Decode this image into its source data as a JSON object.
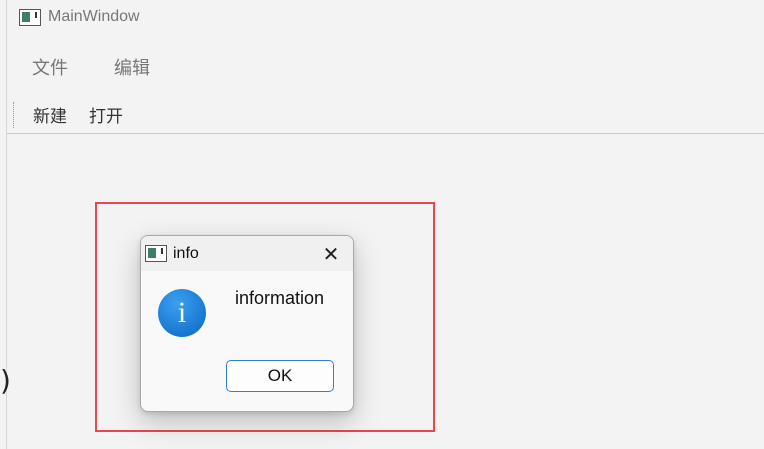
{
  "window": {
    "title": "MainWindow",
    "icon": "app-window-icon"
  },
  "menubar": {
    "items": [
      "文件",
      "编辑"
    ]
  },
  "toolbar": {
    "items": [
      "新建",
      "打开"
    ]
  },
  "dialog": {
    "title": "info",
    "close_label": "✕",
    "message": "information",
    "ok_label": "OK",
    "icon": "info-icon",
    "icon_glyph": "i"
  },
  "colors": {
    "highlight": "#e5484d",
    "accent": "#2f7fd3",
    "info_blue": "#0a67c2"
  },
  "partial_glyph": ")"
}
